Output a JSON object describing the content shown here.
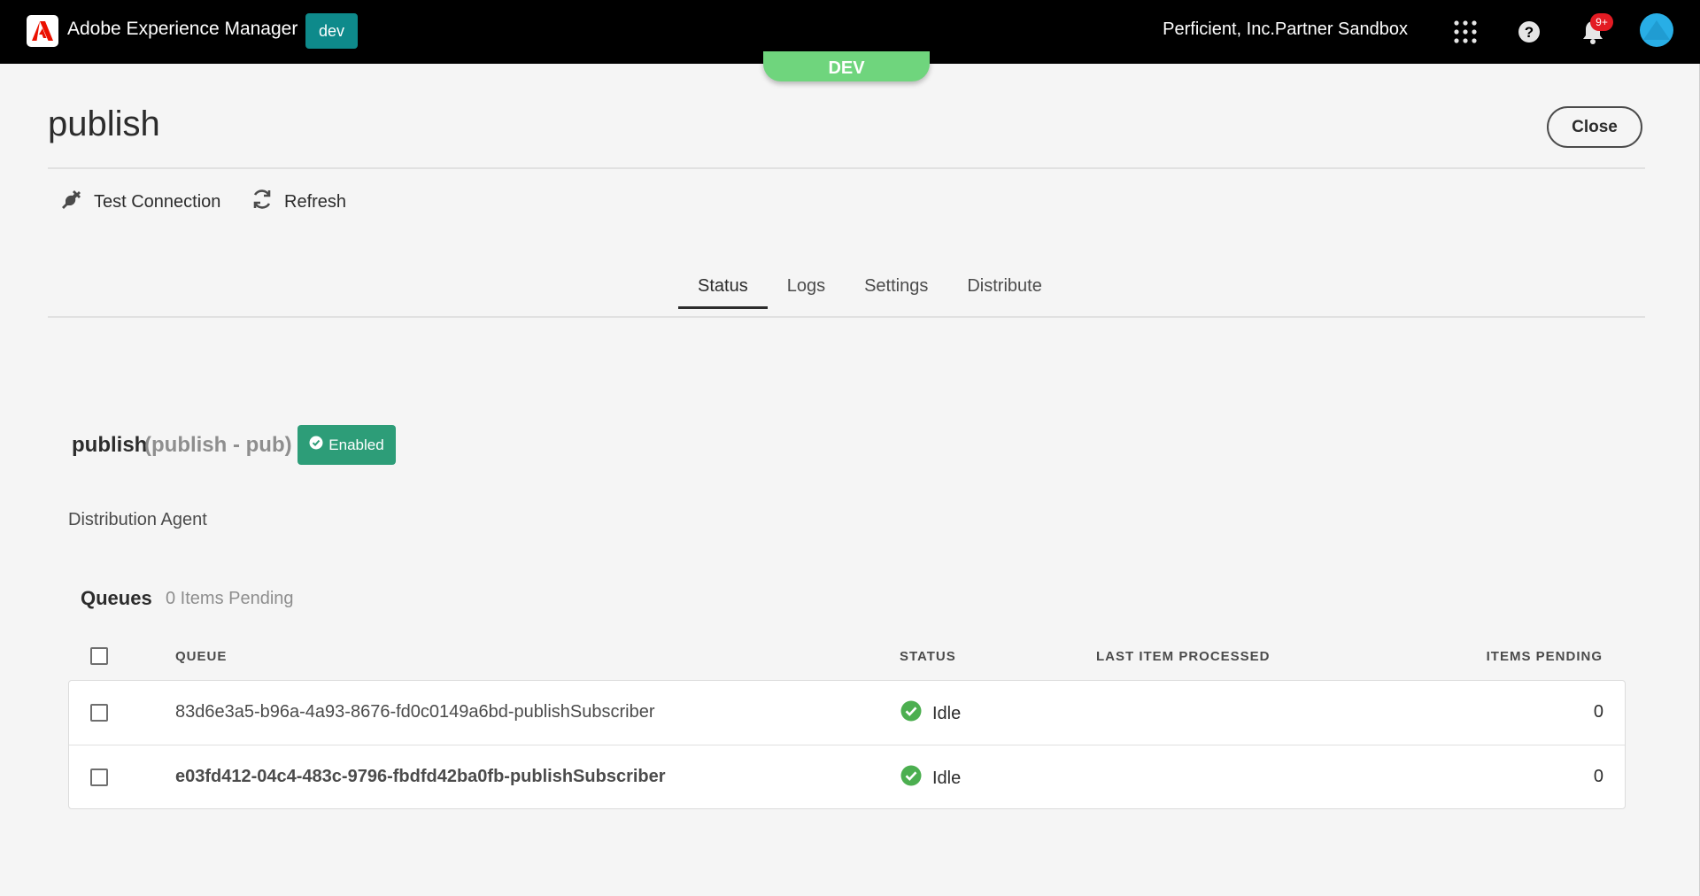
{
  "shell": {
    "app_name": "Adobe Experience Manager",
    "env_badge": "dev",
    "org_name": "Perficient, Inc.Partner Sandbox",
    "notification_count": "9+",
    "icons": [
      "adobe-logo-icon",
      "apps-grid-icon",
      "help-icon",
      "bell-icon",
      "avatar"
    ]
  },
  "environment_pill": "DEV",
  "page": {
    "title": "publish",
    "close_label": "Close"
  },
  "actions": {
    "test_connection": "Test Connection",
    "refresh": "Refresh"
  },
  "tabs": [
    {
      "label": "Status",
      "active": true
    },
    {
      "label": "Logs",
      "active": false
    },
    {
      "label": "Settings",
      "active": false
    },
    {
      "label": "Distribute",
      "active": false
    }
  ],
  "agent": {
    "name": "publish",
    "subtitle": "(publish - pub)",
    "state_label": "Enabled",
    "type": "Distribution Agent"
  },
  "queues": {
    "heading": "Queues",
    "pending_summary": "0 Items Pending",
    "columns": {
      "queue": "QUEUE",
      "status": "STATUS",
      "last_item": "LAST ITEM PROCESSED",
      "items_pending": "ITEMS PENDING"
    },
    "rows": [
      {
        "queue": "83d6e3a5-b96a-4a93-8676-fd0c0149a6bd-publishSubscriber",
        "status": "Idle",
        "last_item": "",
        "items_pending": "0"
      },
      {
        "queue": "e03fd412-04c4-483c-9796-fbdfd42ba0fb-publishSubscriber",
        "status": "Idle",
        "last_item": "",
        "items_pending": "0"
      }
    ]
  },
  "colors": {
    "shell_bg": "#000000",
    "env_badge": "#0e8a8b",
    "dev_pill": "#6fd57d",
    "enabled_badge": "#2d9d78",
    "idle_status": "#4caf50",
    "notification_badge": "#e31b23",
    "avatar": "#28aee6"
  }
}
